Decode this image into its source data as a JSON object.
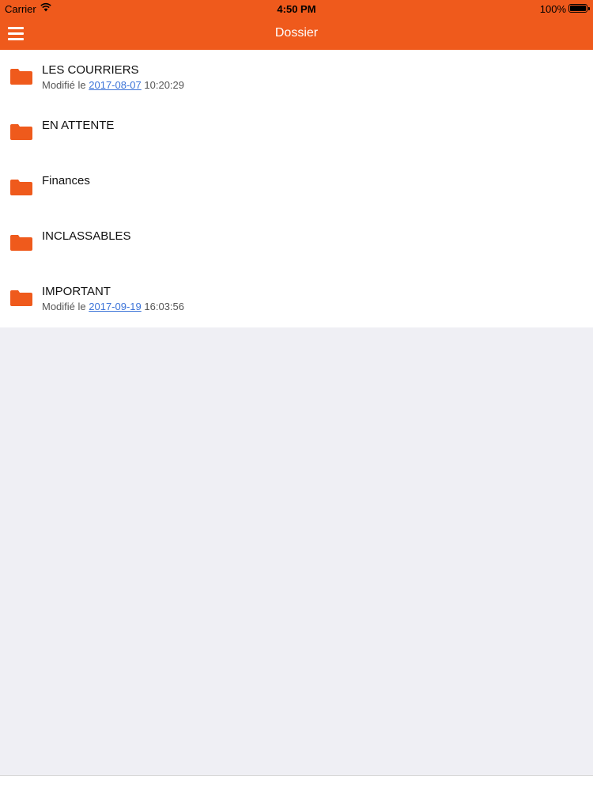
{
  "status_bar": {
    "carrier": "Carrier",
    "time": "4:50 PM",
    "battery": "100%"
  },
  "nav": {
    "title": "Dossier",
    "menu_icon": "hamburger-menu-icon"
  },
  "colors": {
    "accent": "#ef5a1c",
    "link": "#3b73d8",
    "background": "#efeff4"
  },
  "folders": [
    {
      "name": "LES COURRIERS",
      "modified_prefix": "Modifié le",
      "date": "2017-08-07",
      "time": "10:20:29"
    },
    {
      "name": "EN ATTENTE"
    },
    {
      "name": "Finances"
    },
    {
      "name": "INCLASSABLES"
    },
    {
      "name": "IMPORTANT",
      "modified_prefix": "Modifié le",
      "date": "2017-09-19",
      "time": "16:03:56"
    }
  ]
}
